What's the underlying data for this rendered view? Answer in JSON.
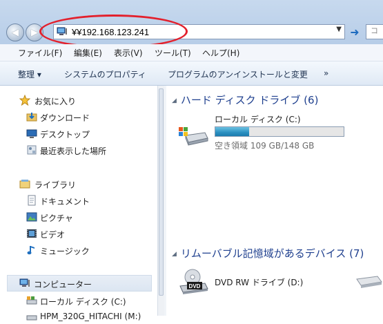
{
  "address": {
    "path": "¥¥192.168.123.241"
  },
  "menu": [
    "ファイル(F)",
    "編集(E)",
    "表示(V)",
    "ツール(T)",
    "ヘルプ(H)"
  ],
  "toolbar": {
    "organize": "整理 ▾",
    "system_properties": "システムのプロパティ",
    "uninstall": "プログラムのアンインストールと変更",
    "more": "»"
  },
  "nav": {
    "favorites": "お気に入り",
    "downloads": "ダウンロード",
    "desktop": "デスクトップ",
    "recent": "最近表示した場所",
    "libraries": "ライブラリ",
    "documents": "ドキュメント",
    "pictures": "ピクチャ",
    "videos": "ビデオ",
    "music": "ミュージック",
    "computer": "コンピューター",
    "local_disk": "ローカル ディスク (C:)",
    "partial": "HPM_320G_HITACHI (M:)"
  },
  "groups": {
    "hdd": "ハード ディスク ドライブ (6)",
    "removable": "リムーバブル記憶域があるデバイス (7)"
  },
  "drives": {
    "c_name": "ローカル ディスク (C:)",
    "c_free": "空き領域 109 GB/148 GB",
    "c_used_fraction": 0.264,
    "dvd_name": "DVD RW ドライブ (D:)",
    "dvd_badge": "DVD"
  },
  "colors": {
    "annotation": "#e3202c",
    "accent": "#1e3f8e"
  }
}
